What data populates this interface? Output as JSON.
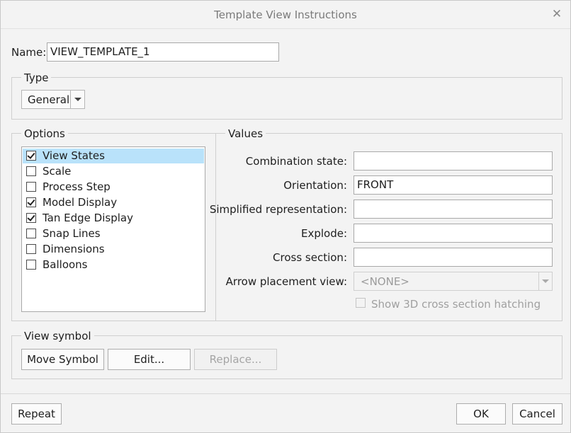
{
  "window": {
    "title": "Template View Instructions"
  },
  "name": {
    "label": "Name:",
    "value": "VIEW_TEMPLATE_1"
  },
  "type": {
    "legend": "Type",
    "selected": "General"
  },
  "options": {
    "legend": "Options",
    "items": [
      {
        "label": "View States",
        "checked": true,
        "selected": true
      },
      {
        "label": "Scale",
        "checked": false
      },
      {
        "label": "Process Step",
        "checked": false
      },
      {
        "label": "Model Display",
        "checked": true
      },
      {
        "label": "Tan Edge Display",
        "checked": true
      },
      {
        "label": "Snap Lines",
        "checked": false
      },
      {
        "label": "Dimensions",
        "checked": false
      },
      {
        "label": "Balloons",
        "checked": false
      }
    ]
  },
  "values": {
    "legend": "Values",
    "combination_state": {
      "label": "Combination state:",
      "value": ""
    },
    "orientation": {
      "label": "Orientation:",
      "value": "FRONT"
    },
    "simplified_rep": {
      "label": "Simplified representation:",
      "value": ""
    },
    "explode": {
      "label": "Explode:",
      "value": ""
    },
    "cross_section": {
      "label": "Cross section:",
      "value": ""
    },
    "arrow_placement": {
      "label": "Arrow placement view:",
      "value": "<NONE>"
    },
    "show_hatching": {
      "label": "Show 3D cross section hatching",
      "checked": false
    }
  },
  "view_symbol": {
    "legend": "View symbol",
    "move_label": "Move Symbol",
    "edit_label": "Edit...",
    "replace_label": "Replace..."
  },
  "footer": {
    "repeat_label": "Repeat",
    "ok_label": "OK",
    "cancel_label": "Cancel"
  }
}
